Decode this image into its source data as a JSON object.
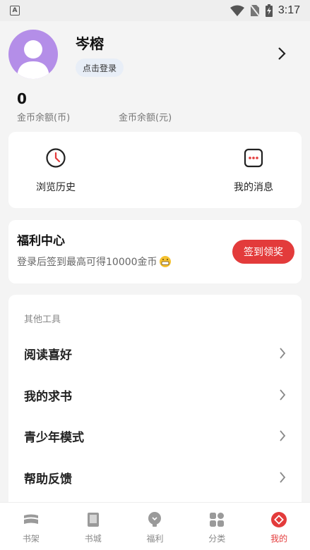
{
  "status_bar": {
    "time": "3:17",
    "app_badge": "A"
  },
  "profile": {
    "name": "岑榕",
    "login_label": "点击登录"
  },
  "coins": {
    "value": "0",
    "label_coin": "金币余额(币)",
    "label_yuan": "金币余额(元)"
  },
  "quick": {
    "history": "浏览历史",
    "messages": "我的消息"
  },
  "welfare": {
    "title": "福利中心",
    "desc": "登录后签到最高可得10000金币",
    "button": "签到领奖"
  },
  "tools": {
    "title": "其他工具",
    "items": [
      {
        "label": "阅读喜好"
      },
      {
        "label": "我的求书"
      },
      {
        "label": "青少年模式"
      },
      {
        "label": "帮助反馈"
      }
    ]
  },
  "nav": {
    "items": [
      {
        "label": "书架"
      },
      {
        "label": "书城"
      },
      {
        "label": "福利"
      },
      {
        "label": "分类"
      },
      {
        "label": "我的"
      }
    ]
  },
  "colors": {
    "accent": "#e33b3b",
    "avatar": "#b48ee8"
  }
}
